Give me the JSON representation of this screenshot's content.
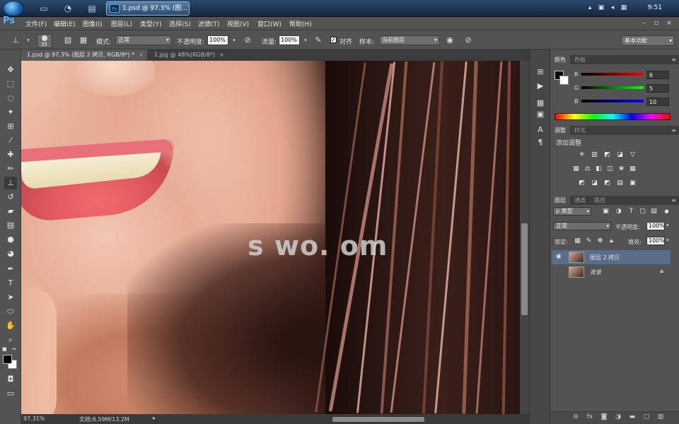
{
  "taskbar": {
    "ps_task_title": "1.psd @ 97.3% (图...",
    "ps_task_icon": "Ps",
    "clock": "9:51"
  },
  "menubar": {
    "logo": "Ps",
    "items": [
      "文件(F)",
      "编辑(E)",
      "图像(I)",
      "图层(L)",
      "类型(Y)",
      "选择(S)",
      "滤镜(T)",
      "视图(V)",
      "窗口(W)",
      "帮助(H)"
    ]
  },
  "options": {
    "brush_size": "35",
    "mode_label": "模式:",
    "mode_value": "正常",
    "opacity_label": "不透明度:",
    "opacity_value": "100%",
    "flow_label": "流量:",
    "flow_value": "100%",
    "aligned_label": "对齐",
    "sample_label": "样本:",
    "sample_value": "当前图层",
    "workspace": "基本功能"
  },
  "tabs": [
    {
      "label": "1.psd @ 97.3% (图层 2 拷贝, RGB/8*) *",
      "close": "×"
    },
    {
      "label": "1.jpg @ 48%(RGB/8*)",
      "close": "×"
    }
  ],
  "canvas": {
    "watermark": "s    wo. om"
  },
  "status": {
    "zoom": "97.31%",
    "doc_info": "文档:6.59M/13.2M"
  },
  "color_panel": {
    "tabs": [
      "颜色",
      "色板"
    ],
    "r_label": "R",
    "g_label": "G",
    "b_label": "B",
    "r_value": "6",
    "g_value": "5",
    "b_value": "10"
  },
  "adjust_panel": {
    "tabs": [
      "调整",
      "样式"
    ],
    "title": "添加调整"
  },
  "layers_panel": {
    "tabs": [
      "图层",
      "通道",
      "路径"
    ],
    "filter_label": "ρ 类型",
    "blend_mode": "正常",
    "opacity_label": "不透明度:",
    "opacity_value": "100%",
    "lock_label": "锁定:",
    "fill_label": "填充:",
    "fill_value": "100%",
    "layers": [
      {
        "name": "图层 2 拷贝",
        "selected": true
      },
      {
        "name": "背景",
        "selected": false
      }
    ]
  },
  "colors": {
    "accent_blue": "#4fb4ff",
    "selected_layer": "#5b6d8c"
  }
}
